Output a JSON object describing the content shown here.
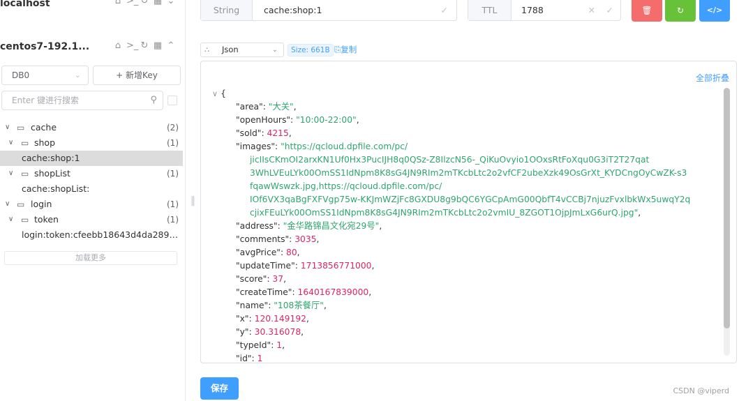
{
  "sidebar": {
    "connections": [
      {
        "name": "localhost"
      },
      {
        "name": "centos7-192.1..."
      }
    ],
    "db_select": "DB0",
    "new_key_label": "+ 新增Key",
    "search_placeholder": "Enter 键进行搜索",
    "tree": {
      "cache": {
        "label": "cache",
        "count": "(2)"
      },
      "shop": {
        "label": "shop",
        "count": "(1)"
      },
      "shop_key": {
        "label": "cache:shop:1"
      },
      "shopList": {
        "label": "shopList",
        "count": "(1)"
      },
      "shopList_key": {
        "label": "cache:shopList:"
      },
      "login": {
        "label": "login",
        "count": "(1)"
      },
      "token": {
        "label": "token",
        "count": "(1)"
      },
      "token_key": {
        "label": "login:token:cfeebb18643d4da2891..."
      }
    },
    "load_more_label": "加载更多"
  },
  "topbar": {
    "type_label": "String",
    "key_name": "cache:shop:1",
    "ttl_label": "TTL",
    "ttl_value": "1788"
  },
  "format": {
    "selected": "Json",
    "size_tag": "Size: 661B",
    "copy_label": "复制"
  },
  "editor": {
    "collapse_all_label": "全部折叠",
    "open_brace": "{",
    "json": {
      "area_key": "\"area\"",
      "area_val": "\"大关\"",
      "openHours_key": "\"openHours\"",
      "openHours_val": "\"10:00-22:00\"",
      "sold_key": "\"sold\"",
      "sold_val": "4215",
      "images_key": "\"images\"",
      "images_line1": "\"https://qcloud.dpfile.com/pc/",
      "images_line2": "jicIIsCKmOI2arxKN1Uf0Hx3PucIJH8q0QSz-Z8IlzcN56-_QiKuOvyio1OOxsRtFoXqu0G3iT2T27qat",
      "images_line3": "3WhLVEuLYk00OmSS1IdNpm8K8sG4JN9RIm2mTKcbLtc2o2vfCF2ubeXzk49OsGrXt_KYDCngOyCwZK-s3",
      "images_line4": "fqawWswzk.jpg,https://qcloud.dpfile.com/pc/",
      "images_line5": "IOf6VX3qaBgFXFVgp75w-KKJmWZjFc8GXDU8g9bQC6YGCpAmG00QbfT4vCCBj7njuzFvxlbkWx5uwqY2q",
      "images_line6": "cjixFEuLYk00OmSS1IdNpm8K8sG4JN9RIm2mTKcbLtc2o2vmIU_8ZGOT1OjpJmLxG6urQ.jpg\"",
      "address_key": "\"address\"",
      "address_val": "\"金华路锦昌文化宛29号\"",
      "comments_key": "\"comments\"",
      "comments_val": "3035",
      "avgPrice_key": "\"avgPrice\"",
      "avgPrice_val": "80",
      "updateTime_key": "\"updateTime\"",
      "updateTime_val": "1713856771000",
      "score_key": "\"score\"",
      "score_val": "37",
      "createTime_key": "\"createTime\"",
      "createTime_val": "1640167839000",
      "name_key": "\"name\"",
      "name_val": "\"108茶餐厅\"",
      "x_key": "\"x\"",
      "x_val": "120.149192",
      "y_key": "\"y\"",
      "y_val": "30.316078",
      "typeId_key": "\"typeId\"",
      "typeId_val": "1",
      "id_key": "\"id\"",
      "id_val": "1"
    }
  },
  "save_label": "保存",
  "watermark": "CSDN @viperd",
  "colors": {
    "primary": "#409eff",
    "danger": "#f56c6c",
    "success": "#67c23a",
    "json_string": "#2fa56f",
    "json_number": "#e0245e"
  }
}
